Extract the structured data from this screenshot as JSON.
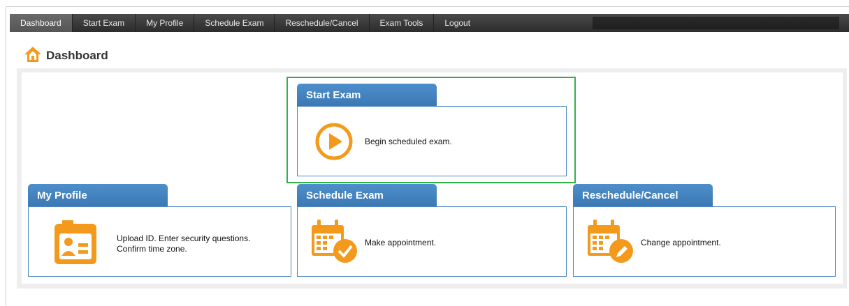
{
  "nav": {
    "items": [
      {
        "label": "Dashboard",
        "active": true
      },
      {
        "label": "Start Exam"
      },
      {
        "label": "My Profile"
      },
      {
        "label": "Schedule Exam"
      },
      {
        "label": "Reschedule/Cancel"
      },
      {
        "label": "Exam Tools"
      },
      {
        "label": "Logout"
      }
    ]
  },
  "page": {
    "title": "Dashboard",
    "title_icon": "home-icon"
  },
  "colors": {
    "accent_orange": "#f39a1c",
    "tab_blue": "#3c79b4",
    "highlight_green": "#34b04a"
  },
  "tiles": {
    "start_exam": {
      "title": "Start Exam",
      "desc": "Begin scheduled exam.",
      "icon": "play-icon"
    },
    "my_profile": {
      "title": "My Profile",
      "desc_line1": "Upload ID. Enter security questions.",
      "desc_line2": "Confirm time zone.",
      "icon": "id-card-icon"
    },
    "schedule_exam": {
      "title": "Schedule Exam",
      "desc": "Make appointment.",
      "icon": "calendar-check-icon"
    },
    "reschedule_cancel": {
      "title": "Reschedule/Cancel",
      "desc": "Change appointment.",
      "icon": "calendar-edit-icon"
    }
  }
}
